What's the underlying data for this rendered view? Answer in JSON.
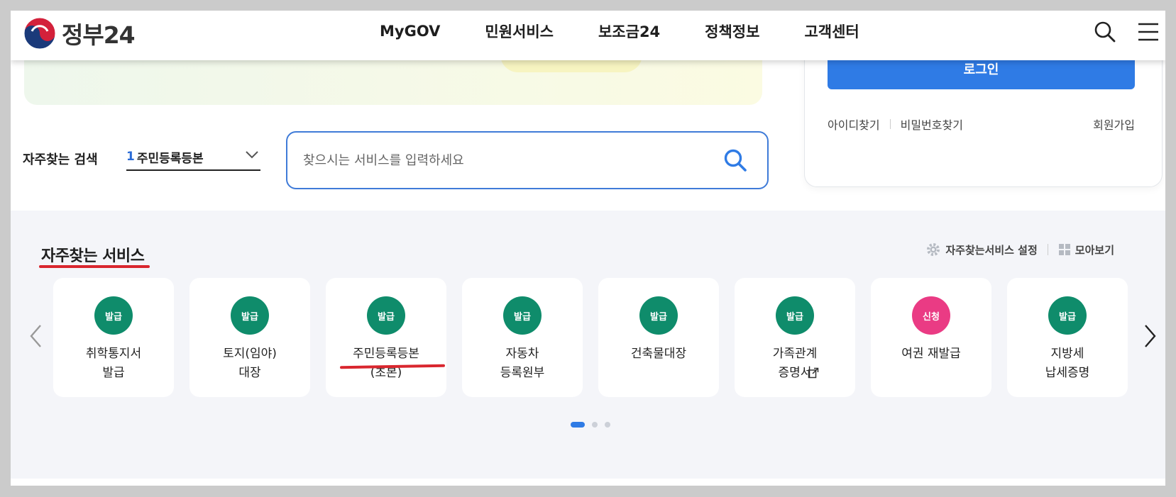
{
  "header": {
    "logo_text": "정부24",
    "nav": [
      "MyGOV",
      "민원서비스",
      "보조금24",
      "정책정보",
      "고객센터"
    ]
  },
  "login": {
    "button_label": "로그인",
    "find_id": "아이디찾기",
    "find_pw": "비밀번호찾기",
    "join": "회원가입"
  },
  "fav_search": {
    "label": "자주찾는 검색",
    "rank": "1",
    "selected": "주민등록등본"
  },
  "search": {
    "placeholder": "찾으시는 서비스를 입력하세요"
  },
  "services": {
    "title": "자주찾는 서비스",
    "settings_label": "자주찾는서비스 설정",
    "collect_label": "모아보기",
    "items": [
      {
        "badge": "발급",
        "label": "취학통지서\n발급"
      },
      {
        "badge": "발급",
        "label": "토지(임야)\n대장"
      },
      {
        "badge": "발급",
        "label": "주민등록등본\n(초본)"
      },
      {
        "badge": "발급",
        "label": "자동차\n등록원부"
      },
      {
        "badge": "발급",
        "label": "건축물대장"
      },
      {
        "badge": "발급",
        "label": "가족관계\n증명서"
      },
      {
        "badge": "신청",
        "label": "여권 재발급"
      },
      {
        "badge": "발급",
        "label": "지방세\n납세증명"
      }
    ],
    "pagination_count": 3,
    "active_page": 1
  },
  "colors": {
    "badge_issue": "#0f8c6b",
    "badge_apply": "#ea3b84",
    "primary_blue": "#2f7be5",
    "annotation_red": "#d9262e"
  }
}
